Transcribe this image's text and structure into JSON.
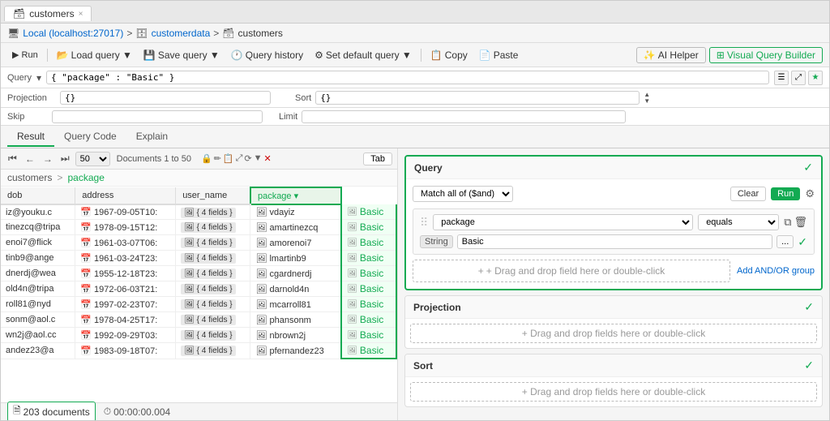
{
  "tab": {
    "label": "customers",
    "close": "×"
  },
  "breadcrumb": {
    "server": "Local (localhost:27017)",
    "db": "customerdata",
    "collection": "customers",
    "sep1": ">",
    "sep2": ">"
  },
  "toolbar": {
    "run_label": "▶ Run",
    "load_query_label": "Load query ▼",
    "save_query_label": "Save query ▼",
    "query_history_label": "Query history",
    "set_default_label": "Set default query ▼",
    "copy_label": "Copy",
    "paste_label": "Paste",
    "ai_helper_label": "AI Helper",
    "visual_query_builder_label": "Visual Query Builder"
  },
  "query_bar": {
    "label": "Query",
    "value": "{ \"package\" : \"Basic\" }",
    "arrow_label": "▾"
  },
  "projection_bar": {
    "label": "Projection",
    "value": "{}",
    "sort_label": "Sort",
    "sort_value": "{}"
  },
  "skip_limit_bar": {
    "skip_label": "Skip",
    "skip_value": "",
    "limit_label": "Limit",
    "limit_value": ""
  },
  "result_tabs": {
    "items": [
      {
        "label": "Result",
        "active": true
      },
      {
        "label": "Query Code",
        "active": false
      },
      {
        "label": "Explain",
        "active": false
      }
    ]
  },
  "data_toolbar": {
    "prev_prev": "⏮",
    "prev": "←",
    "next": "→",
    "next_next": "⏭",
    "page_size": "50",
    "doc_range": "Documents 1 to 50",
    "tab_btn": "Tab"
  },
  "collection_path": {
    "base": "customers",
    "sep": ">",
    "field": "package"
  },
  "table": {
    "columns": [
      "dob",
      "address",
      "user_name",
      "package"
    ],
    "rows": [
      {
        "dob": "1967-09-05T10:",
        "address": "{ 4 fields }",
        "user_name": "vdayiz",
        "package": "Basic",
        "email": "iz@youku.c"
      },
      {
        "dob": "1978-09-15T12:",
        "address": "{ 4 fields }",
        "user_name": "amartinezcq",
        "package": "Basic",
        "email": "tinezcq@tripa"
      },
      {
        "dob": "1961-03-07T06:",
        "address": "{ 4 fields }",
        "user_name": "amorenoi7",
        "package": "Basic",
        "email": "enoi7@flick"
      },
      {
        "dob": "1961-03-24T23:",
        "address": "{ 4 fields }",
        "user_name": "lmartinb9",
        "package": "Basic",
        "email": "tinb9@ange"
      },
      {
        "dob": "1955-12-18T23:",
        "address": "{ 4 fields }",
        "user_name": "cgardnerdj",
        "package": "Basic",
        "email": "dnerdj@wea"
      },
      {
        "dob": "1972-06-03T21:",
        "address": "{ 4 fields }",
        "user_name": "darnold4n",
        "package": "Basic",
        "email": "old4n@tripa"
      },
      {
        "dob": "1997-02-23T07:",
        "address": "{ 4 fields }",
        "user_name": "mcarroll81",
        "package": "Basic",
        "email": "roll81@nyd"
      },
      {
        "dob": "1978-04-25T17:",
        "address": "{ 4 fields }",
        "user_name": "phansonm",
        "package": "Basic",
        "email": "sonm@aol.c"
      },
      {
        "dob": "1992-09-29T03:",
        "address": "{ 4 fields }",
        "user_name": "nbrown2j",
        "package": "Basic",
        "email": "wn2j@aol.cc"
      },
      {
        "dob": "1983-09-18T07:",
        "address": "{ 4 fields }",
        "user_name": "pfernandez23",
        "package": "Basic",
        "email": "andez23@a"
      }
    ]
  },
  "status_bar": {
    "doc_count_icon": "🗎",
    "doc_count": "203 documents",
    "timer_icon": "⏱",
    "timer": "00:00:00.004"
  },
  "query_builder": {
    "title": "Query",
    "check": "✓",
    "match_label": "Match all of ($and)",
    "clear_btn": "Clear",
    "run_btn": "Run",
    "filter": {
      "drag": "⠿",
      "field": "package",
      "operator": "equals",
      "type": "String",
      "value": "Basic",
      "dots_btn": "...",
      "check": "✓"
    },
    "drop_zone": "+ Drag and drop field here or double-click",
    "add_and_or": "Add AND/OR group"
  },
  "projection_panel": {
    "title": "Projection",
    "check": "✓",
    "drop_zone": "+ Drag and drop fields here or double-click"
  },
  "sort_panel": {
    "title": "Sort",
    "check": "✓",
    "drop_zone": "+ Drag and drop fields here or double-click"
  }
}
